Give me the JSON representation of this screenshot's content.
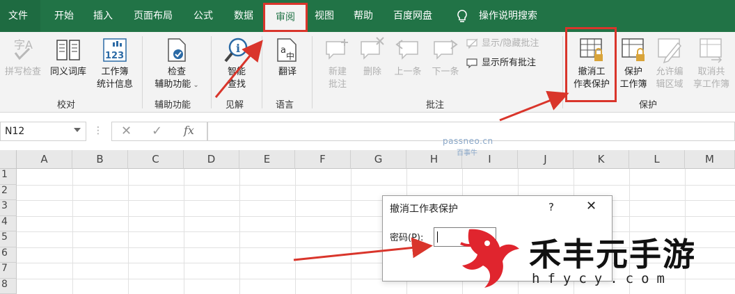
{
  "menubar": {
    "file": "文件",
    "tabs": [
      "开始",
      "插入",
      "页面布局",
      "公式",
      "数据",
      "审阅",
      "视图",
      "帮助",
      "百度网盘"
    ],
    "active_tab": "审阅",
    "tell_me": "操作说明搜索"
  },
  "ribbon": {
    "proofing": {
      "spell": "拼写检查",
      "thesaurus": "同义词库",
      "stats_line1": "工作簿",
      "stats_line2": "统计信息",
      "label": "校对"
    },
    "accessibility": {
      "check_line1": "检查",
      "check_line2": "辅助功能",
      "label": "辅助功能"
    },
    "insights": {
      "smart_line1": "智能",
      "smart_line2": "查找",
      "label": "见解"
    },
    "language": {
      "translate": "翻译",
      "label": "语言"
    },
    "comments": {
      "new_line1": "新建",
      "new_line2": "批注",
      "delete": "删除",
      "prev": "上一条",
      "next": "下一条",
      "show_hide": "显示/隐藏批注",
      "show_all": "显示所有批注",
      "label": "批注"
    },
    "protect": {
      "unprotect_line1": "撤消工",
      "unprotect_line2": "作表保护",
      "protect_wb_line1": "保护",
      "protect_wb_line2": "工作簿",
      "allow_line1": "允许编",
      "allow_line2": "辑区域",
      "unshare_line1": "取消共",
      "unshare_line2": "享工作簿",
      "label": "保护"
    }
  },
  "formula_bar": {
    "name_box": "N12",
    "cancel": "✕",
    "enter": "✓",
    "fx": "fx",
    "formula": ""
  },
  "grid": {
    "columns": [
      "A",
      "B",
      "C",
      "D",
      "E",
      "F",
      "G",
      "H",
      "I",
      "J",
      "K",
      "L",
      "M"
    ],
    "rows": [
      "1",
      "2",
      "3",
      "4",
      "5",
      "6",
      "7",
      "8"
    ]
  },
  "dialog": {
    "title": "撤消工作表保护",
    "help": "?",
    "close": "✕",
    "password_label": "密码(P):",
    "password_value": ""
  },
  "watermark": {
    "site": "passneo.cn",
    "site_sub": "百事牛",
    "logo_text": "禾丰元手游",
    "logo_url": "hfycy.com"
  },
  "colors": {
    "ribbon_green": "#217346",
    "highlight_red": "#d9352b"
  }
}
